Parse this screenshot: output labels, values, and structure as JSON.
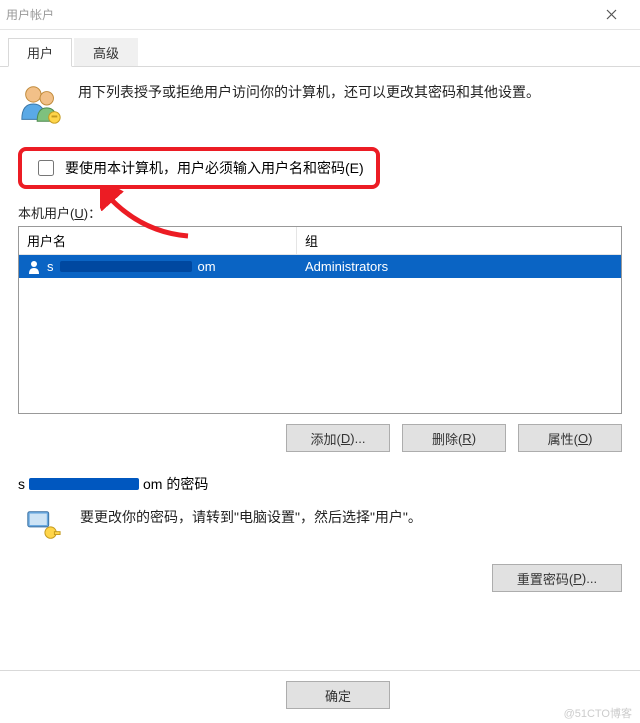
{
  "window": {
    "title": "用户帐户"
  },
  "tabs": {
    "user": "用户",
    "advanced": "高级"
  },
  "intro": "用下列表授予或拒绝用户访问你的计算机，还可以更改其密码和其他设置。",
  "checkbox": {
    "label": "要使用本计算机，用户必须输入用户名和密码(E)"
  },
  "section": {
    "local_users": "本机用户(U)："
  },
  "table": {
    "headers": {
      "user": "用户名",
      "group": "组"
    },
    "rows": [
      {
        "user_prefix": "s",
        "user_masked": true,
        "user_suffix": "om",
        "group": "Administrators"
      }
    ]
  },
  "buttons": {
    "add": "添加(D)...",
    "remove": "删除(R)",
    "properties": "属性(O)",
    "reset_pw": "重置密码(P)...",
    "ok": "确定"
  },
  "pw_section": {
    "prefix": "s",
    "suffix": "om 的密码",
    "text": "要更改你的密码，请转到\"电脑设置\"，然后选择\"用户\"。"
  },
  "watermark": "@51CTO博客"
}
